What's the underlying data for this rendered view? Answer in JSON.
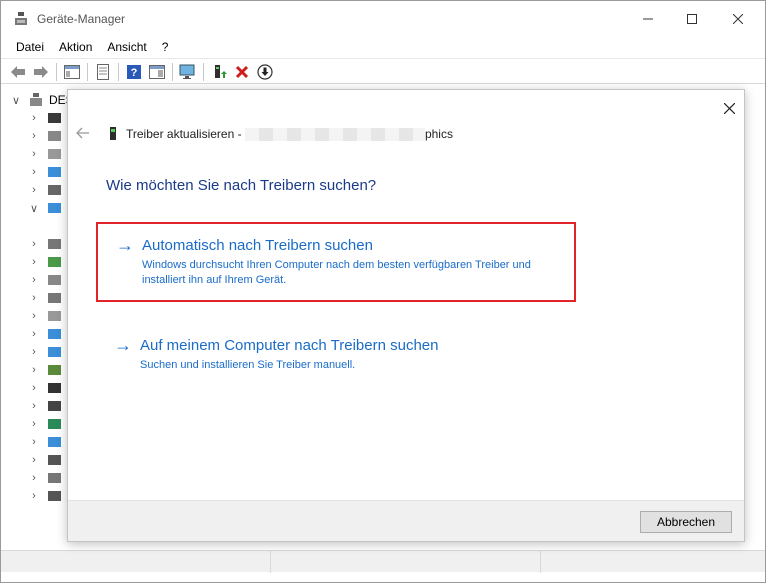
{
  "window": {
    "title": "Geräte-Manager"
  },
  "menu": [
    "Datei",
    "Aktion",
    "Ansicht",
    "?"
  ],
  "tree": {
    "root_label": "DES",
    "rows": [
      {
        "chev": "∨",
        "icon": "computer-icon"
      },
      {
        "chev": "›",
        "icon": "battery-icon"
      },
      {
        "chev": "›",
        "icon": "audio-icon"
      },
      {
        "chev": "›",
        "icon": "speaker-icon"
      },
      {
        "chev": "›",
        "icon": "monitor-icon"
      },
      {
        "chev": "›",
        "icon": "printer-icon"
      },
      {
        "chev": "∨",
        "icon": "display-adapter-icon"
      },
      {
        "chev": "",
        "icon": ""
      },
      {
        "chev": "›",
        "icon": "keyboard-icon"
      },
      {
        "chev": "›",
        "icon": "network-adapter-icon"
      },
      {
        "chev": "›",
        "icon": "storage-controller-icon"
      },
      {
        "chev": "›",
        "icon": "disk-drive-icon"
      },
      {
        "chev": "›",
        "icon": "mouse-icon"
      },
      {
        "chev": "›",
        "icon": "monitor-icon"
      },
      {
        "chev": "›",
        "icon": "network-icon"
      },
      {
        "chev": "›",
        "icon": "processor-icon"
      },
      {
        "chev": "›",
        "icon": "software-device-icon"
      },
      {
        "chev": "›",
        "icon": "software-component-icon"
      },
      {
        "chev": "›",
        "icon": "sound-device-icon"
      },
      {
        "chev": "›",
        "icon": "system-device-icon"
      },
      {
        "chev": "›",
        "icon": "usb-controller-icon"
      },
      {
        "chev": "›",
        "icon": "keyboard-icon"
      },
      {
        "chev": "›",
        "icon": "usb-device-icon"
      }
    ]
  },
  "dialog": {
    "header_prefix": "Treiber aktualisieren - ",
    "header_suffix": "phics",
    "question": "Wie möchten Sie nach Treibern suchen?",
    "option_auto": {
      "title": "Automatisch nach Treibern suchen",
      "desc": "Windows durchsucht Ihren Computer nach dem besten verfügbaren Treiber und installiert ihn auf Ihrem Gerät."
    },
    "option_manual": {
      "title": "Auf meinem Computer nach Treibern suchen",
      "desc": "Suchen und installieren Sie Treiber manuell."
    },
    "cancel_label": "Abbrechen"
  },
  "colors": {
    "accent": "#1a6cc8",
    "heading": "#1a3a8a",
    "highlight": "#e0242a"
  }
}
